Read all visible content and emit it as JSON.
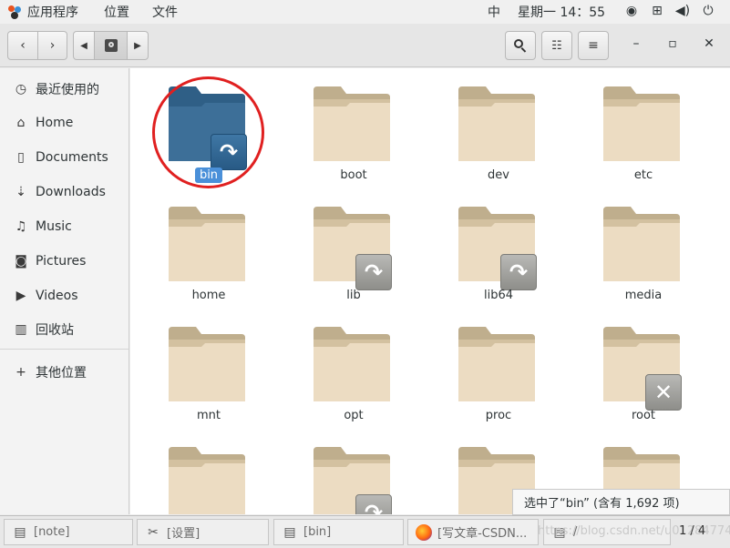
{
  "topbar": {
    "apps_label": "应用程序",
    "places_label": "位置",
    "files_label": "文件",
    "ime": "中",
    "clock": "星期一 14：55",
    "tray_icons": [
      "accessibility-icon",
      "network-icon",
      "volume-icon",
      "power-icon"
    ]
  },
  "header": {
    "back_icon": "chevron-left-icon",
    "forward_icon": "chevron-right-icon",
    "path_prev_icon": "triangle-left-icon",
    "path_icon": "disk-icon",
    "path_next_icon": "triangle-right-icon",
    "search_icon": "search-icon",
    "view_icon": "list-view-icon",
    "menu_icon": "hamburger-icon",
    "min_glyph": "–",
    "max_glyph": "▫",
    "close_glyph": "✕"
  },
  "sidebar": {
    "items": [
      {
        "label": "最近使用的",
        "icon": "clock-icon",
        "glyph": "◷"
      },
      {
        "label": "Home",
        "icon": "home-icon",
        "glyph": "⌂"
      },
      {
        "label": "Documents",
        "icon": "document-icon",
        "glyph": "▯"
      },
      {
        "label": "Downloads",
        "icon": "download-icon",
        "glyph": "⇣"
      },
      {
        "label": "Music",
        "icon": "music-icon",
        "glyph": "♫"
      },
      {
        "label": "Pictures",
        "icon": "camera-icon",
        "glyph": "◙"
      },
      {
        "label": "Videos",
        "icon": "video-icon",
        "glyph": "▶"
      },
      {
        "label": "回收站",
        "icon": "trash-icon",
        "glyph": "▥"
      },
      {
        "label": "其他位置",
        "icon": "plus-icon",
        "glyph": "+"
      }
    ]
  },
  "folders": [
    {
      "name": "bin",
      "badge": "link",
      "selected": true
    },
    {
      "name": "boot",
      "badge": "",
      "selected": false
    },
    {
      "name": "dev",
      "badge": "",
      "selected": false
    },
    {
      "name": "etc",
      "badge": "",
      "selected": false
    },
    {
      "name": "home",
      "badge": "",
      "selected": false
    },
    {
      "name": "lib",
      "badge": "link",
      "selected": false
    },
    {
      "name": "lib64",
      "badge": "link",
      "selected": false
    },
    {
      "name": "media",
      "badge": "",
      "selected": false
    },
    {
      "name": "mnt",
      "badge": "",
      "selected": false
    },
    {
      "name": "opt",
      "badge": "",
      "selected": false
    },
    {
      "name": "proc",
      "badge": "",
      "selected": false
    },
    {
      "name": "root",
      "badge": "locked",
      "selected": false
    },
    {
      "name": "",
      "badge": "",
      "selected": false
    },
    {
      "name": "",
      "badge": "link",
      "selected": false
    },
    {
      "name": "",
      "badge": "",
      "selected": false
    },
    {
      "name": "",
      "badge": "",
      "selected": false
    }
  ],
  "status": "选中了“bin” (含有 1,692 项)",
  "taskbar": {
    "tasks": [
      {
        "label": "[note]",
        "icon": "window-icon"
      },
      {
        "label": "[设置]",
        "icon": "tools-icon"
      },
      {
        "label": "[bin]",
        "icon": "window-icon"
      },
      {
        "label": "[写文章-CSDN...",
        "icon": "firefox-icon"
      },
      {
        "label": "/",
        "icon": "window-icon"
      }
    ],
    "watermark": "https://blog.csdn.net/u012847747",
    "pager": "1 / 4"
  },
  "colors": {
    "folder_tab": "#bfae8d",
    "folder_body": "#ecdcc2",
    "folder_selected": "#3d6f98",
    "selection": "#4a90d9",
    "highlight_circle": "#e02020"
  }
}
